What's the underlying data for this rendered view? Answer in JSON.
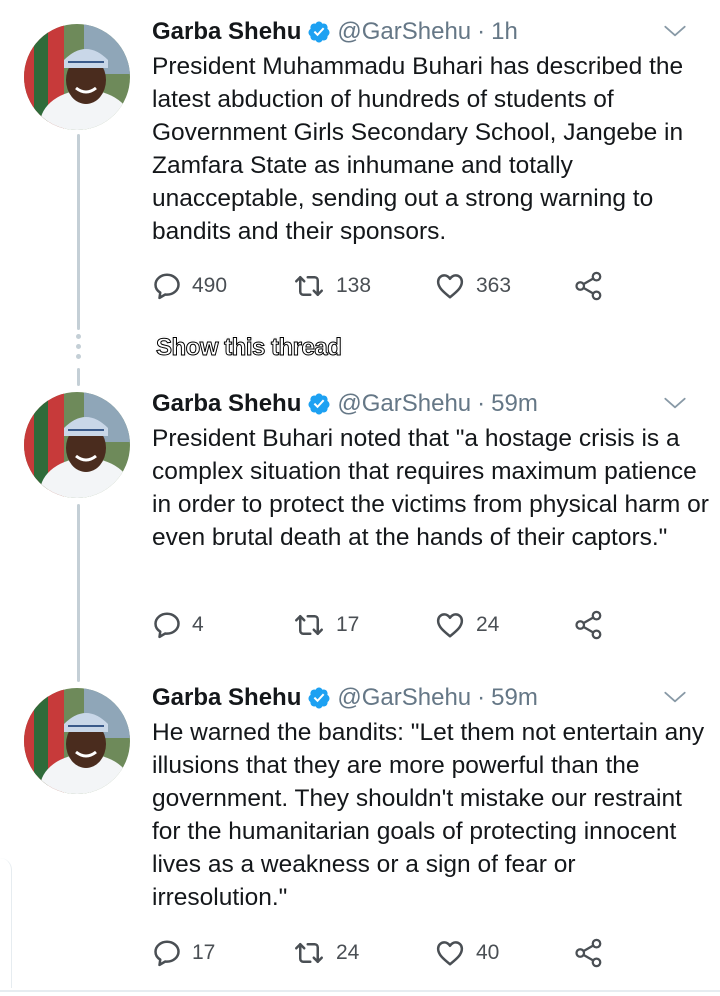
{
  "show_thread_label": "Show this thread",
  "tweets": [
    {
      "name": "Garba Shehu",
      "handle": "@GarShehu",
      "separator": "·",
      "time": "1h",
      "text": "President Muhammadu Buhari has described the latest abduction of hundreds of students of Government Girls Secondary School, Jangebe in Zamfara State as inhumane and totally unacceptable, sending out a strong warning to bandits and their sponsors.",
      "replies": "490",
      "retweets": "138",
      "likes": "363"
    },
    {
      "name": "Garba Shehu",
      "handle": "@GarShehu",
      "separator": "·",
      "time": "59m",
      "text": "President Buhari noted that \"a hostage crisis is a complex situation that requires maximum patience in order to protect the victims from physical harm or even brutal death at the hands of their captors.\"",
      "replies": "4",
      "retweets": "17",
      "likes": "24"
    },
    {
      "name": "Garba Shehu",
      "handle": "@GarShehu",
      "separator": "·",
      "time": "59m",
      "text": "He warned the bandits: \"Let them not entertain any illusions that they are more powerful than the government. They shouldn't mistake our restraint for the humanitarian goals of protecting innocent lives as a weakness or a sign of fear or irresolution.\"",
      "replies": "17",
      "retweets": "24",
      "likes": "40"
    }
  ],
  "colors": {
    "verified": "#1da1f2",
    "secondary_text": "#657786",
    "thread_line": "#c4cfd6",
    "icon": "#4a4f54"
  },
  "icons": [
    "verified-badge-icon",
    "chevron-down-icon",
    "reply-icon",
    "retweet-icon",
    "like-icon",
    "share-icon"
  ]
}
